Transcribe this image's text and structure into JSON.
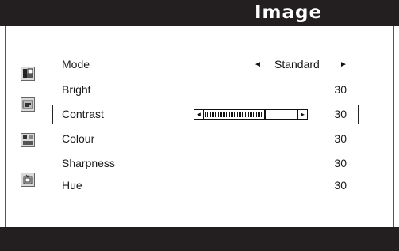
{
  "header": {
    "title": "Image"
  },
  "menu": {
    "items": [
      {
        "label": "Mode",
        "value": "Standard"
      },
      {
        "label": "Bright",
        "value": "30"
      },
      {
        "label": "Contrast",
        "value": "30",
        "selected": true,
        "slider_level": 0.62
      },
      {
        "label": "Colour",
        "value": "30"
      },
      {
        "label": "Sharpness",
        "value": "30"
      },
      {
        "label": "Hue",
        "value": "30"
      }
    ],
    "mode_left_arrow": "◄",
    "mode_right_arrow": "►"
  },
  "icons": [
    "picture-mode-icon",
    "brightness-icon",
    "color-adjust-icon",
    "tint-icon"
  ]
}
